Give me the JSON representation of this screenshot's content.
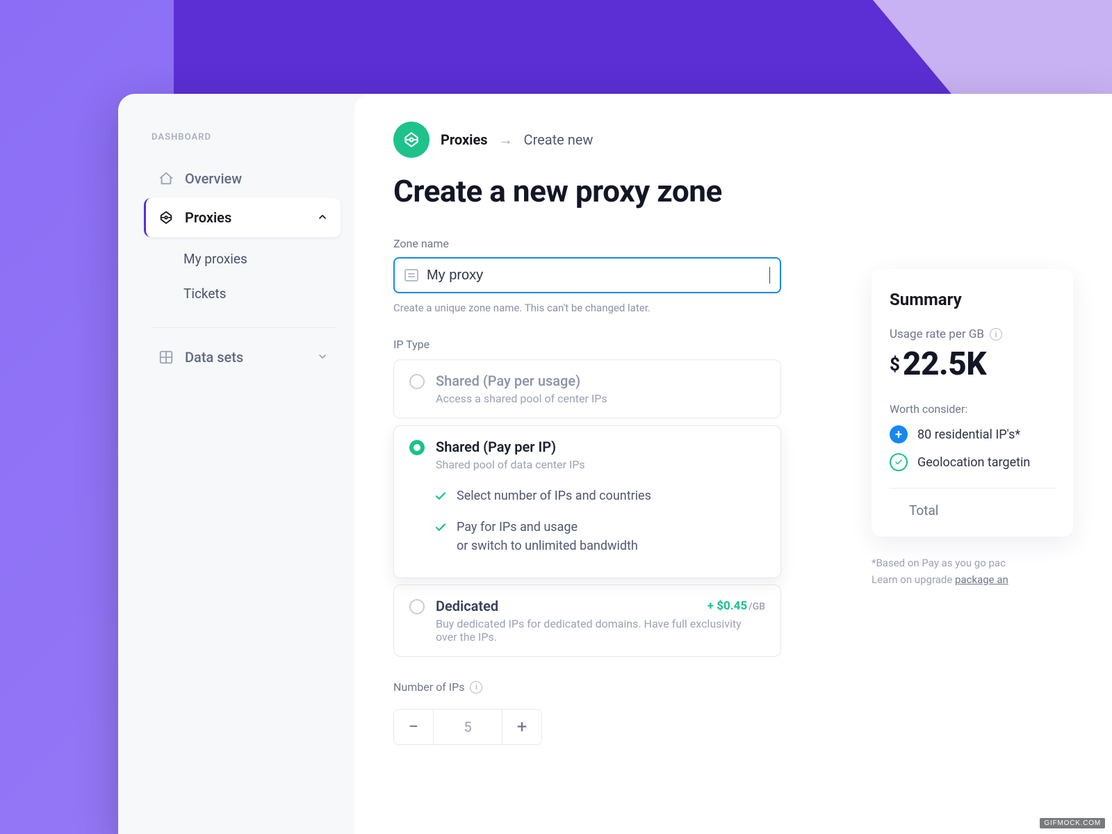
{
  "sidebar": {
    "heading": "DASHBOARD",
    "items": {
      "overview": "Overview",
      "proxies": "Proxies",
      "datasets": "Data sets"
    },
    "sub": {
      "my_proxies": "My proxies",
      "tickets": "Tickets"
    }
  },
  "breadcrumb": {
    "root": "Proxies",
    "current": "Create new"
  },
  "page": {
    "title": "Create a new proxy zone"
  },
  "form": {
    "zone_label": "Zone name",
    "zone_value": "My proxy",
    "zone_help": "Create a unique zone name. This can't be changed later.",
    "ip_type_label": "IP Type",
    "options": {
      "shared_usage": {
        "title": "Shared (Pay per usage)",
        "desc": "Access a shared pool of center IPs"
      },
      "shared_ip": {
        "title": "Shared (Pay per IP)",
        "desc": "Shared pool of data center IPs",
        "feature1": "Select number of IPs and countries",
        "feature2": "Pay for IPs and usage\nor switch to unlimited bandwidth"
      },
      "dedicated": {
        "title": "Dedicated",
        "desc": "Buy dedicated IPs for dedicated domains. Have full exclusivity over the IPs.",
        "price": "+ $0.45",
        "price_unit": "/GB"
      }
    },
    "num_ips_label": "Number of IPs",
    "num_ips_value": "5"
  },
  "summary": {
    "title": "Summary",
    "rate_label": "Usage rate per GB",
    "currency": "$",
    "price_value": "22.5K",
    "worth_label": "Worth consider:",
    "item1": "80 residential IP's*",
    "item2": "Geolocation targetin",
    "total_label": "Total",
    "footnote_line1": "*Based on Pay as you go pac",
    "footnote_line2_a": "Learn on upgrade ",
    "footnote_link": "package an"
  },
  "watermark": "GIFMOCK.COM"
}
